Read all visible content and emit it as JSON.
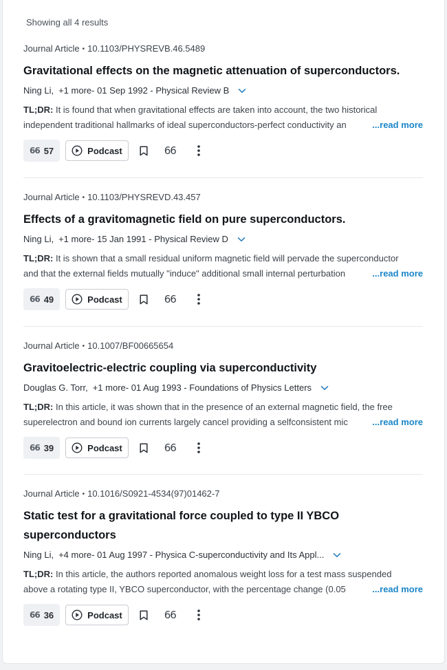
{
  "results_count": "Showing all 4 results",
  "colors": {
    "accent": "#1b86c9",
    "divider": "#e6e8eb"
  },
  "results": [
    {
      "type": "Journal Article",
      "doi": "10.1103/PHYSREVB.46.5489",
      "title": "Gravitational effects on the magnetic attenuation of superconductors.",
      "author": "Ning Li,",
      "more": "+1 more",
      "details": "- 01 Sep 1992 - Physical Review B",
      "tldr_label": "TL;DR:",
      "tldr_line1": "It is found that when gravitational effects are taken into account, the two historical",
      "tldr_line2": "independent traditional hallmarks of ideal superconductors-perfect conductivity an",
      "read_more": "...read more",
      "citations": "57",
      "podcast_label": "Podcast",
      "quote_label": "66"
    },
    {
      "type": "Journal Article",
      "doi": "10.1103/PHYSREVD.43.457",
      "title": "Effects of a gravitomagnetic field on pure superconductors.",
      "author": "Ning Li,",
      "more": "+1 more",
      "details": "- 15 Jan 1991 - Physical Review D",
      "tldr_label": "TL;DR:",
      "tldr_line1": "It is shown that a small residual uniform magnetic field will pervade the superconductor",
      "tldr_line2": "and that the external fields mutually \"induce\" additional small internal perturbation",
      "read_more": "...read more",
      "citations": "49",
      "podcast_label": "Podcast",
      "quote_label": "66"
    },
    {
      "type": "Journal Article",
      "doi": "10.1007/BF00665654",
      "title": "Gravitoelectric-electric coupling via superconductivity",
      "author": "Douglas G. Torr,",
      "more": "+1 more",
      "details": "- 01 Aug 1993 - Foundations of Physics Letters",
      "tldr_label": "TL;DR:",
      "tldr_line1": "In this article, it was shown that in the presence of an external magnetic field, the free",
      "tldr_line2": "superelectron and bound ion currents largely cancel providing a selfconsistent mic",
      "read_more": "...read more",
      "citations": "39",
      "podcast_label": "Podcast",
      "quote_label": "66"
    },
    {
      "type": "Journal Article",
      "doi": "10.1016/S0921-4534(97)01462-7",
      "title": "Static test for a gravitational force coupled to type II YBCO superconductors",
      "author": "Ning Li,",
      "more": "+4 more",
      "details": "- 01 Aug 1997 - Physica C-superconductivity and Its Appl...",
      "tldr_label": "TL;DR:",
      "tldr_line1": "In this article, the authors reported anomalous weight loss for a test mass suspended",
      "tldr_line2": "above a rotating type II, YBCO superconductor, with the percentage change (0.05",
      "read_more": "...read more",
      "citations": "36",
      "podcast_label": "Podcast",
      "quote_label": "66"
    }
  ]
}
